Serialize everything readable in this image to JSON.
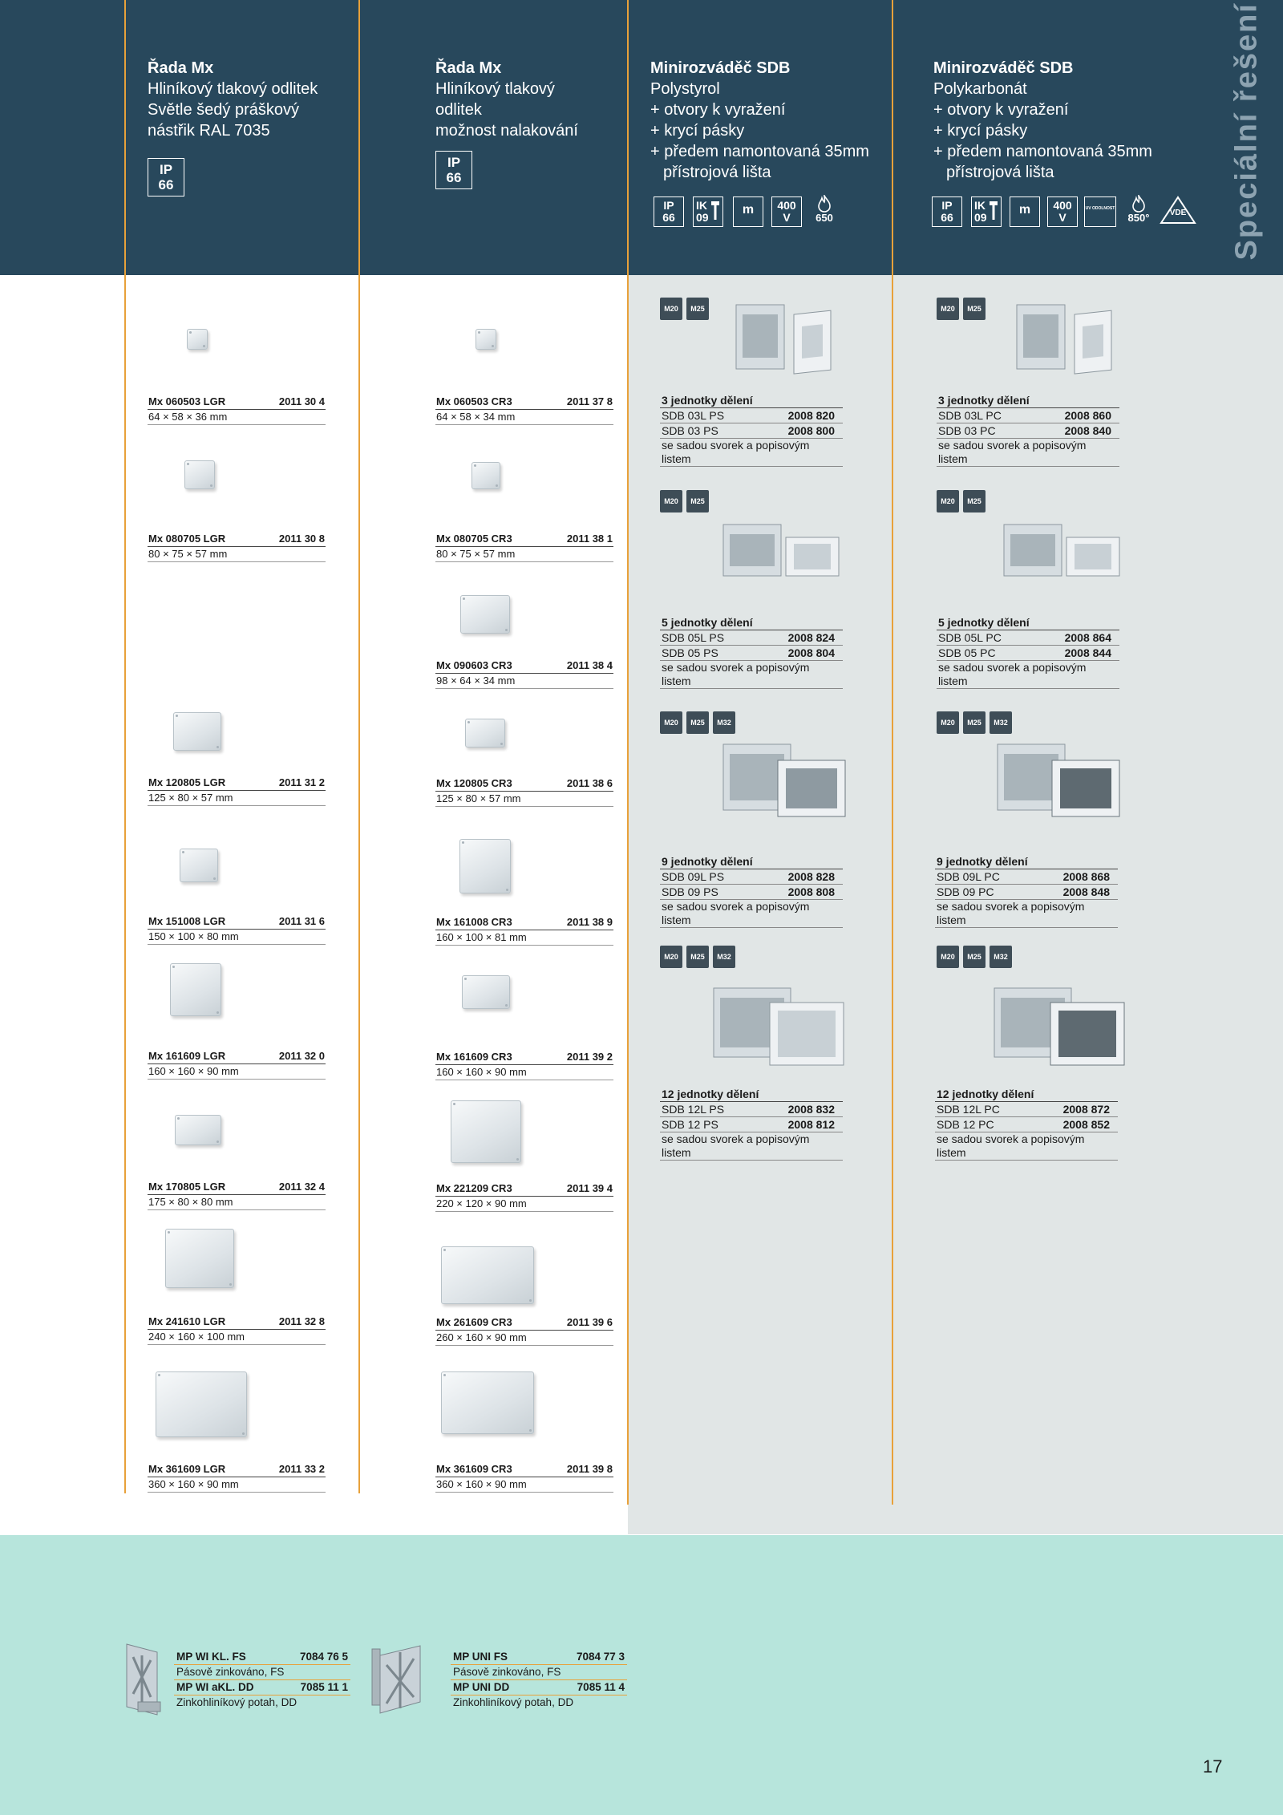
{
  "header": {
    "col1": {
      "title": "Řada Mx",
      "lines": [
        "Hliníkový tlakový odlitek",
        "Světle šedý práškový",
        "nástřik RAL 7035"
      ],
      "ip_label": "IP",
      "ip_value": "66"
    },
    "col2": {
      "title": "Řada Mx",
      "lines": [
        "Hliníkový tlakový",
        "odlitek",
        "možnost nalakování"
      ],
      "ip_label": "IP",
      "ip_value": "66"
    },
    "col3": {
      "title": "Minirozváděč SDB",
      "lines": [
        "Polystyrol",
        "+ otvory k vyražení",
        "+ krycí pásky",
        "+ předem namontovaná 35mm",
        "přístrojová lišta"
      ],
      "badges": {
        "ip": "IP",
        "ip_v": "66",
        "ik": "IK",
        "ik_v": "09",
        "m": "m",
        "volt": "400",
        "volt_unit": "V",
        "glow": "650"
      }
    },
    "col4": {
      "title": "Minirozváděč SDB",
      "lines": [
        "Polykarbonát",
        "+ otvory k vyražení",
        "+ krycí pásky",
        "+ předem namontovaná 35mm",
        "přístrojová lišta"
      ],
      "badges": {
        "ip": "IP",
        "ip_v": "66",
        "ik": "IK",
        "ik_v": "09",
        "m": "m",
        "volt": "400",
        "volt_unit": "V",
        "uv": "UV ODOLNOST",
        "glow": "850°",
        "vde": "VDE"
      }
    },
    "vertical_title": "Speciální řešení"
  },
  "mx_lgr": [
    {
      "name": "Mx 060503 LGR",
      "code": "2011 30 4",
      "dims": "64 × 58 × 36 mm"
    },
    {
      "name": "Mx 080705 LGR",
      "code": "2011 30 8",
      "dims": "80 × 75 × 57 mm"
    },
    {
      "name": "Mx 120805 LGR",
      "code": "2011 31 2",
      "dims": "125 × 80 × 57 mm"
    },
    {
      "name": "Mx 151008 LGR",
      "code": "2011 31 6",
      "dims": "150 × 100 × 80 mm"
    },
    {
      "name": "Mx 161609 LGR",
      "code": "2011 32 0",
      "dims": "160 × 160 × 90 mm"
    },
    {
      "name": "Mx 170805 LGR",
      "code": "2011 32 4",
      "dims": "175 × 80 × 80 mm"
    },
    {
      "name": "Mx 241610 LGR",
      "code": "2011 32 8",
      "dims": "240 × 160 × 100 mm"
    },
    {
      "name": "Mx 361609 LGR",
      "code": "2011 33 2",
      "dims": "360 × 160 × 90 mm"
    }
  ],
  "mx_cr3": [
    {
      "name": "Mx 060503 CR3",
      "code": "2011 37 8",
      "dims": "64 × 58 × 34 mm"
    },
    {
      "name": "Mx 080705 CR3",
      "code": "2011 38 1",
      "dims": "80 × 75 × 57 mm"
    },
    {
      "name": "Mx 090603 CR3",
      "code": "2011 38 4",
      "dims": "98 × 64 × 34 mm"
    },
    {
      "name": "Mx 120805 CR3",
      "code": "2011 38 6",
      "dims": "125 × 80 × 57 mm"
    },
    {
      "name": "Mx 161008 CR3",
      "code": "2011 38 9",
      "dims": "160 × 100 × 81 mm"
    },
    {
      "name": "Mx 161609 CR3",
      "code": "2011 39 2",
      "dims": "160 × 160 × 90 mm"
    },
    {
      "name": "Mx 221209 CR3",
      "code": "2011 39 4",
      "dims": "220 × 120 × 90 mm"
    },
    {
      "name": "Mx 261609 CR3",
      "code": "2011 39 6",
      "dims": "260 × 160 × 90 mm"
    },
    {
      "name": "Mx 361609 CR3",
      "code": "2011 39 8",
      "dims": "360 × 160 × 90 mm"
    }
  ],
  "sdb_ps": [
    {
      "heading": "3 jednotky dělení",
      "r1_name": "SDB 03L PS",
      "r1_code": "2008 820",
      "r2_name": "SDB 03 PS",
      "r2_code": "2008 800",
      "note1": "se sadou svorek a popisovým",
      "note2": "listem",
      "tags": [
        "M20",
        "M25"
      ]
    },
    {
      "heading": "5 jednotky dělení",
      "r1_name": "SDB 05L PS",
      "r1_code": "2008 824",
      "r2_name": "SDB 05 PS",
      "r2_code": "2008 804",
      "note1": "se sadou svorek a popisovým",
      "note2": "listem",
      "tags": [
        "M20",
        "M25"
      ]
    },
    {
      "heading": "9 jednotky dělení",
      "r1_name": "SDB 09L PS",
      "r1_code": "2008 828",
      "r2_name": "SDB 09 PS",
      "r2_code": "2008 808",
      "note1": "se sadou svorek a popisovým",
      "note2": "listem",
      "tags": [
        "M20",
        "M25",
        "M32"
      ]
    },
    {
      "heading": "12 jednotky dělení",
      "r1_name": "SDB 12L PS",
      "r1_code": "2008 832",
      "r2_name": "SDB 12 PS",
      "r2_code": "2008 812",
      "note1": "se sadou svorek a popisovým",
      "note2": "listem",
      "tags": [
        "M20",
        "M25",
        "M32"
      ]
    }
  ],
  "sdb_pc": [
    {
      "heading": "3 jednotky dělení",
      "r1_name": "SDB 03L PC",
      "r1_code": "2008 860",
      "r2_name": "SDB 03 PC",
      "r2_code": "2008 840",
      "note1": "se sadou svorek a popisovým",
      "note2": "listem",
      "tags": [
        "M20",
        "M25"
      ]
    },
    {
      "heading": "5 jednotky dělení",
      "r1_name": "SDB 05L PC",
      "r1_code": "2008 864",
      "r2_name": "SDB 05 PC",
      "r2_code": "2008 844",
      "note1": "se sadou svorek a popisovým",
      "note2": "listem",
      "tags": [
        "M20",
        "M25"
      ]
    },
    {
      "heading": "9 jednotky dělení",
      "r1_name": "SDB 09L PC",
      "r1_code": "2008 868",
      "r2_name": "SDB 09 PC",
      "r2_code": "2008 848",
      "note1": "se sadou svorek a popisovým",
      "note2": "listem",
      "tags": [
        "M20",
        "M25",
        "M32"
      ]
    },
    {
      "heading": "12 jednotky dělení",
      "r1_name": "SDB 12L PC",
      "r1_code": "2008 872",
      "r2_name": "SDB 12 PC",
      "r2_code": "2008 852",
      "note1": "se sadou svorek a popisovým",
      "note2": "listem",
      "tags": [
        "M20",
        "M25",
        "M32"
      ]
    }
  ],
  "accessories": [
    {
      "r1_name": "MP WI KL. FS",
      "r1_code": "7084 76 5",
      "d1": "Pásově zinkováno, FS",
      "r2_name": "MP WI aKL. DD",
      "r2_code": "7085 11 1",
      "d2": "Zinkohliníkový potah, DD"
    },
    {
      "r1_name": "MP UNI FS",
      "r1_code": "7084 77 3",
      "d1": "Pásově zinkováno, FS",
      "r2_name": "MP UNI DD",
      "r2_code": "7085 11 4",
      "d2": "Zinkohliníkový potah, DD"
    }
  ],
  "page_number": "17",
  "colors": {
    "header_bg": "#28485c",
    "accent_line": "#e8a13a",
    "gray_panel": "#e1e6e6",
    "footer_bg": "#b7e5dc",
    "tag_bg": "#3e4d57"
  }
}
